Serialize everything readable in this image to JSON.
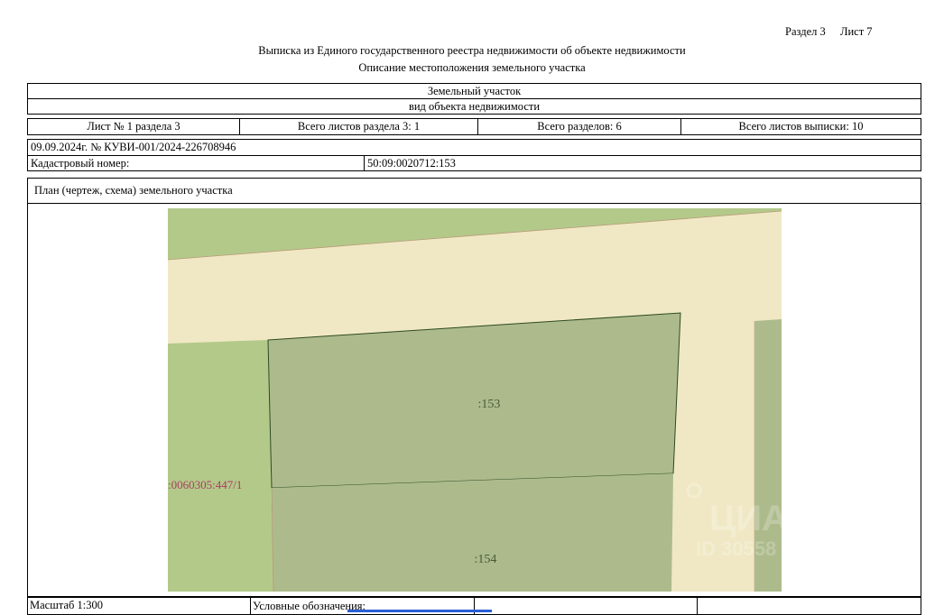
{
  "header": {
    "section_label": "Раздел 3",
    "sheet_label": "Лист 7",
    "title": "Выписка из Единого государственного реестра недвижимости об объекте недвижимости",
    "subtitle": "Описание местоположения земельного участка"
  },
  "object": {
    "type": "Земельный участок",
    "type_caption": "вид объекта недвижимости"
  },
  "sheets_row": {
    "sheet_of_section": "Лист № 1 раздела 3",
    "total_sheets_section": "Всего листов раздела 3: 1",
    "total_sections": "Всего разделов: 6",
    "total_sheets_extract": "Всего листов выписки: 10"
  },
  "extract": {
    "date_number": "09.09.2024г. № КУВИ-001/2024-226708946",
    "cadastral_label": "Кадастровый номер:",
    "cadastral_number": "50:09:0020712:153"
  },
  "plan": {
    "title": "План (чертеж, схема) земельного участка",
    "labels": {
      "parcel_153": ":153",
      "parcel_154": ":154",
      "neighbor": ":0060305:447/1"
    },
    "watermark": "ЦИАН",
    "watermark_id": "ID 30558"
  },
  "footer": {
    "scale": "Масштаб 1:300",
    "legend": "Условные обозначения:"
  },
  "colors": {
    "road": "#f0e8c4",
    "parcel": "#adbb8c",
    "land_green": "#b3c98a",
    "neighbor_label": "#a84060",
    "border": "#000000"
  }
}
